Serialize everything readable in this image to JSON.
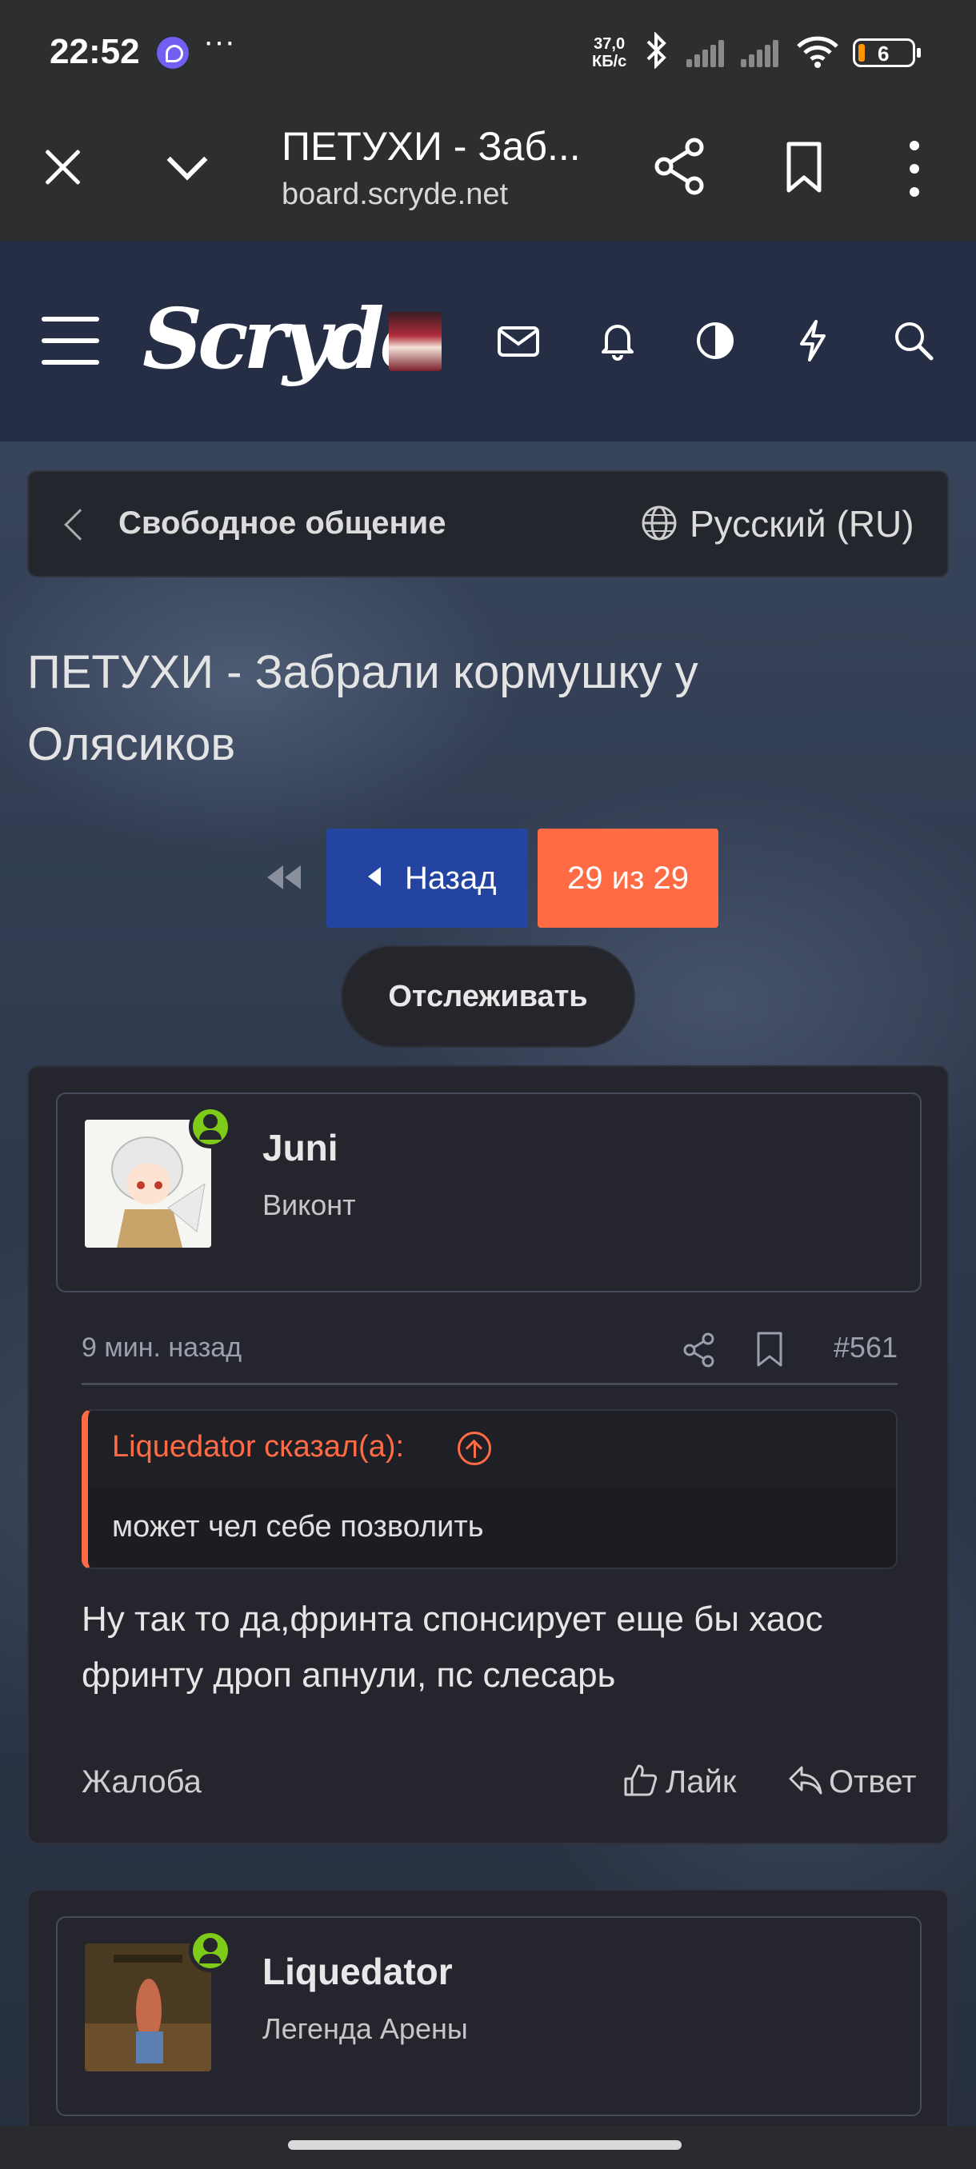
{
  "status_bar": {
    "time": "22:52",
    "more": "···",
    "net_speed_value": "37,0",
    "net_speed_unit": "КБ/с",
    "battery": "6"
  },
  "browser": {
    "page_title": "ПЕТУХИ - Заб...",
    "url": "board.scryde.net"
  },
  "site": {
    "logo": "Scryde"
  },
  "breadcrumb": {
    "label": "Свободное общение",
    "language": "Русский (RU)"
  },
  "thread": {
    "title": "ПЕТУХИ - Забрали кормушку у Олясиков"
  },
  "pagination": {
    "prev_label": "Назад",
    "page_indicator": "29 из 29"
  },
  "watch_label": "Отслеживать",
  "posts": [
    {
      "username": "Juni",
      "user_title": "Виконт",
      "time": "9 мин. назад",
      "number": "#561",
      "quote_author": "Liquedator сказал(а):",
      "quote_text": "может чел себе позволить",
      "text": "Ну так то да,фринта спонсирует еще бы хаос фринту дроп апнули, пс слесарь",
      "report_label": "Жалоба",
      "like_label": "Лайк",
      "reply_label": "Ответ"
    },
    {
      "username": "Liquedator",
      "user_title": "Легенда Арены"
    }
  ],
  "colors": {
    "accent": "#ff6b45",
    "primary_button": "#2444a2",
    "online": "#7ecb1a",
    "header_bg": "#252e44",
    "card_bg": "#25262d"
  },
  "icons": [
    "close-icon",
    "chevron-down-icon",
    "share-icon",
    "bookmark-icon",
    "more-vert-icon",
    "hamburger-icon",
    "mail-icon",
    "bell-icon",
    "theme-contrast-icon",
    "lightning-icon",
    "search-icon",
    "globe-icon",
    "first-page-icon",
    "quote-up-icon",
    "like-icon",
    "reply-icon"
  ]
}
